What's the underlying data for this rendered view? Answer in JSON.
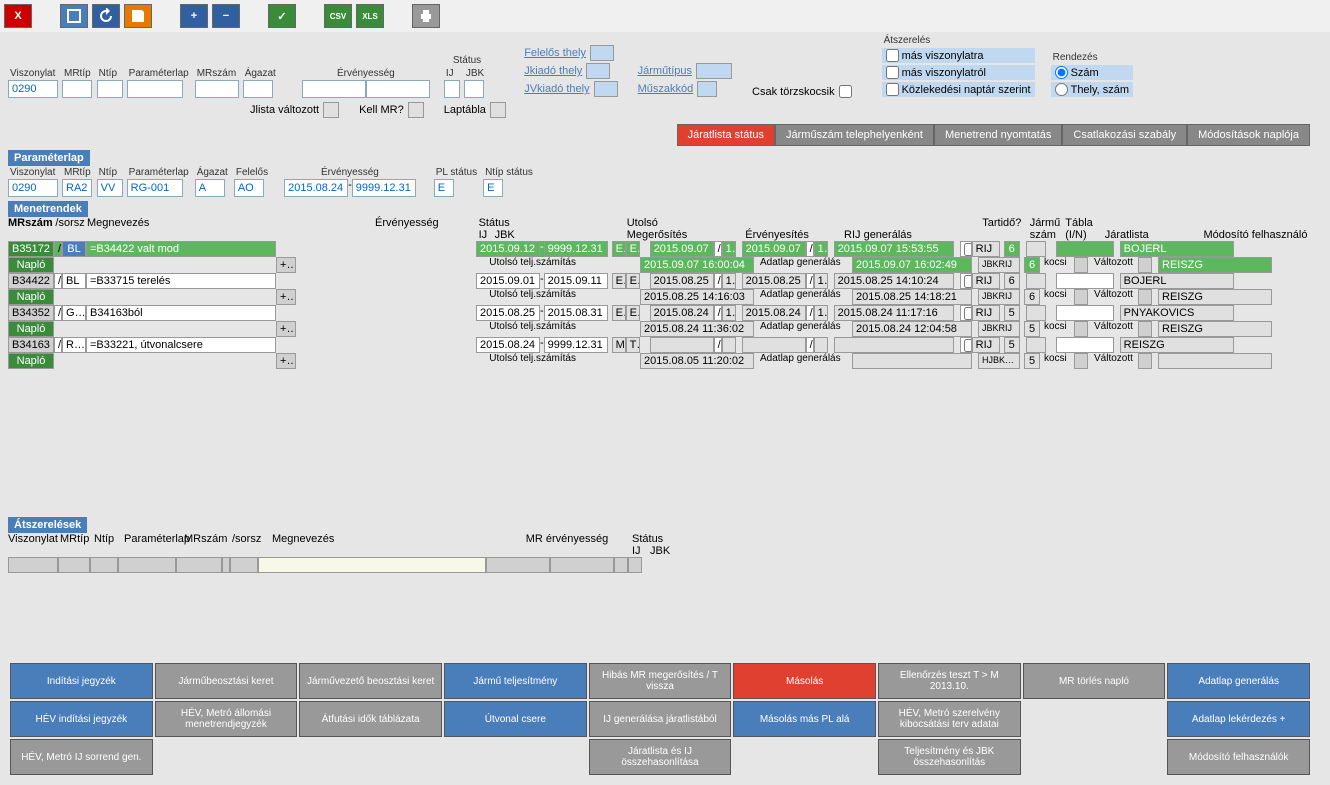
{
  "toolbar": {
    "close": "X",
    "csv": "CSV",
    "xls": "XLS"
  },
  "filters": {
    "header_status": "Státus",
    "viszonylat_label": "Viszonylat",
    "viszonylat": "0290",
    "mrtip_label": "MRtíp",
    "mrtip": "",
    "ntip_label": "Ntíp",
    "ntip": "",
    "parameterlap_label": "Paraméterlap",
    "parameterlap": "",
    "mrszam_label": "MRszám",
    "mrszam": "",
    "agazat_label": "Ágazat",
    "agazat": "",
    "ervenyesseg_label": "Érvényesség",
    "erv_from": "",
    "erv_to": "",
    "ij_label": "IJ",
    "jbk_label": "JBK",
    "felelos_thely": "Felelős thely",
    "jkiado_thely": "Jkiadó thely",
    "jvkiado_thely": "JVkiadó thely",
    "jarmutipus": "Járműtípus",
    "muszakkod": "Műszakkód",
    "csak_torzs": "Csak törzskocsik",
    "jlista_valtozott": "Jlista változott",
    "kell_mr": "Kell MR?",
    "laptabla": "Laptábla",
    "atszereles_label": "Átszerelés",
    "atsz1": "más viszonylatra",
    "atsz2": "más viszonylatról",
    "atsz3": "Közlekedési naptár szerint",
    "rendezes_label": "Rendezés",
    "rend1": "Szám",
    "rend2": "Thely, szám"
  },
  "tabs": {
    "t1": "Járatlista státus",
    "t2": "Járműszám telephelyenként",
    "t3": "Menetrend nyomtatás",
    "t4": "Csatlakozási szabály",
    "t5": "Módosítások naplója"
  },
  "param_section": {
    "title": "Paraméterlap",
    "viszonylat_label": "Viszonylat",
    "viszonylat": "0290",
    "mrtip_label": "MRtíp",
    "mrtip": "RA2",
    "ntip_label": "Ntíp",
    "ntip": "VV",
    "parameterlap_label": "Paraméterlap",
    "parameterlap": "RG-001",
    "agazat_label": "Ágazat",
    "agazat": "A",
    "felelos_label": "Felelős",
    "felelos": "AO",
    "ervenyesseg_label": "Érvényesség",
    "erv_from": "2015.08.24",
    "erv_to": "9999.12.31",
    "pl_status_label": "PL státus",
    "pl_status": "E",
    "ntip_status_label": "Ntíp státus",
    "ntip_status": "E"
  },
  "mr_section": {
    "title": "Menetrendek",
    "h_mrszam": "MRszám",
    "h_sorsz": "/sorsz",
    "h_megnev": "Megnevezés",
    "h_erv": "Érvényesség",
    "h_status": "Státus",
    "h_ij": "IJ",
    "h_jbk": "JBK",
    "h_utolso": "Utolsó",
    "h_megerosites": "Megerősítés",
    "h_ervenyesites": "Érvényesítés",
    "h_rij": "RIJ generálás",
    "h_tartido": "Tartidő?",
    "h_jarmu_szam": "Jármű szám",
    "h_tabla": "Tábla (I/N)",
    "h_jaratlista": "Járatlista",
    "h_modosito": "Módosító felhasználó",
    "utolso_telj": "Utolsó telj.számítás",
    "adatlap_gen": "Adatlap generálás",
    "naplo": "Napló",
    "kocsi": "kocsi",
    "valtozott": "Változott",
    "rows": [
      {
        "mrszam": "B35172",
        "sorsz": "BL",
        "megnev": "=B34422 valt mod",
        "erv_from": "2015.09.12",
        "erv_to": "9999.12.31",
        "ij": "E",
        "jbk": "E",
        "megerosites": "2015.09.07",
        "meg_n": "1",
        "ervenyesites": "2015.09.07",
        "erv_n": "1",
        "rij_gen": "2015.09.07 15:53:55",
        "rij_chk": "RIJ",
        "jarmu": "6",
        "utolso_telj_ts": "2015.09.07 16:00:04",
        "adatlap_ts": "2015.09.07 16:02:49",
        "jbkrij": "JBKRIJ",
        "jbkrij_n": "6",
        "user1": "BOJERL",
        "user2": "REISZG",
        "green": true
      },
      {
        "mrszam": "B34422",
        "sorsz": "BL",
        "megnev": "=B33715 terelés",
        "erv_from": "2015.09.01",
        "erv_to": "2015.09.11",
        "ij": "E",
        "jbk": "E",
        "megerosites": "2015.08.25",
        "meg_n": "1",
        "ervenyesites": "2015.08.25",
        "erv_n": "1",
        "rij_gen": "2015.08.25 14:10:24",
        "rij_chk": "RIJ",
        "jarmu": "6",
        "utolso_telj_ts": "2015.08.25 14:16:03",
        "adatlap_ts": "2015.08.25 14:18:21",
        "jbkrij": "JBKRIJ",
        "jbkrij_n": "6",
        "user1": "BOJERL",
        "user2": "REISZG",
        "green": false
      },
      {
        "mrszam": "B34352",
        "sorsz": "GER",
        "megnev": "B34163ból",
        "erv_from": "2015.08.25",
        "erv_to": "2015.08.31",
        "ij": "E",
        "jbk": "E",
        "megerosites": "2015.08.24",
        "meg_n": "1",
        "ervenyesites": "2015.08.24",
        "erv_n": "1",
        "rij_gen": "2015.08.24 11:17:16",
        "rij_chk": "RIJ",
        "jarmu": "5",
        "utolso_telj_ts": "2015.08.24 11:36:02",
        "adatlap_ts": "2015.08.24 12:04:58",
        "jbkrij": "JBKRIJ",
        "jbkrij_n": "5",
        "user1": "PNYAKOVICS",
        "user2": "REISZG",
        "green": false
      },
      {
        "mrszam": "B34163",
        "sorsz": "RG",
        "megnev": "=B33221, útvonalcsere",
        "erv_from": "2015.08.24",
        "erv_to": "9999.12.31",
        "ij": "M",
        "jbk": "T",
        "megerosites": "",
        "meg_n": "",
        "ervenyesites": "",
        "erv_n": "",
        "rij_gen": "",
        "rij_chk": "RIJ",
        "jarmu": "5",
        "utolso_telj_ts": "2015.08.05 11:20:02",
        "adatlap_ts": "",
        "jbkrij": "HJBKRIJ",
        "jbkrij_n": "5",
        "user1": "REISZG",
        "user2": "",
        "green": false
      }
    ]
  },
  "atsz_section": {
    "title": "Átszerelések",
    "h_viszonylat": "Viszonylat",
    "h_mrtip": "MRtíp",
    "h_ntip": "Ntíp",
    "h_parameterlap": "Paraméterlap",
    "h_mrszam": "MRszám",
    "h_sorsz": "/sorsz",
    "h_megnev": "Megnevezés",
    "h_mr_erv": "MR érvényesség",
    "h_status": "Státus",
    "h_ij": "IJ",
    "h_jbk": "JBK"
  },
  "bottom": {
    "r1c1": "Indítási jegyzék",
    "r1c2": "Járműbeosztási keret",
    "r1c3": "Járművezető beosztási keret",
    "r1c4": "Jármű teljesítmény",
    "r1c5": "Hibás MR megerősítés / T vissza",
    "r1c6": "Másolás",
    "r1c7": "Ellenőrzés teszt T > M 2013.10.",
    "r1c8": "MR törlés napló",
    "r1c9": "Adatlap generálás",
    "r2c1": "HÉV indítási jegyzék",
    "r2c2": "HÉV, Metró állomási menetrendjegyzék",
    "r2c3": "Átfutási idők táblázata",
    "r2c4": "Útvonal csere",
    "r2c5": "IJ generálása járatlistából",
    "r2c6": "Másolás más PL alá",
    "r2c7": "HÉV, Metró szerelvény kibocsátási terv adatai",
    "r2c9": "Adatlap lekérdezés +",
    "r3c1": "HÉV, Metró IJ sorrend gen.",
    "r3c5": "Járatlista és IJ összehasonlítása",
    "r3c7": "Teljesítmény és JBK összehasonlítás",
    "r3c9": "Módosító felhasználók"
  }
}
